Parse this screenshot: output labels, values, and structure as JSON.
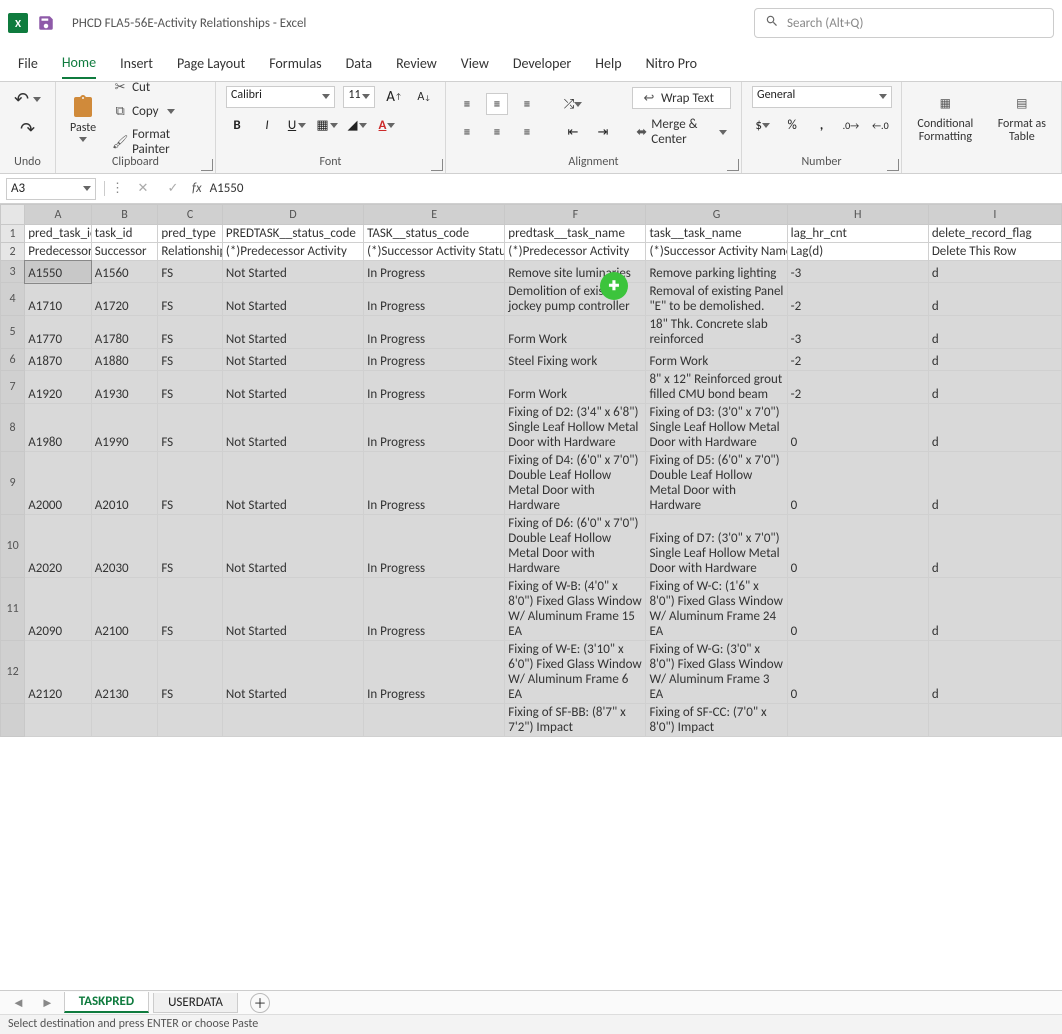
{
  "title": "PHCD FLA5-56E-Activity Relationships  -  Excel",
  "search_placeholder": "Search (Alt+Q)",
  "menu": [
    "File",
    "Home",
    "Insert",
    "Page Layout",
    "Formulas",
    "Data",
    "Review",
    "View",
    "Developer",
    "Help",
    "Nitro Pro"
  ],
  "menu_active": "Home",
  "ribbon": {
    "undo": "Undo",
    "clipboard": {
      "label": "Clipboard",
      "paste": "Paste",
      "cut": "Cut",
      "copy": "Copy",
      "format_painter": "Format Painter"
    },
    "font": {
      "label": "Font",
      "name": "Calibri",
      "size": "11"
    },
    "alignment": {
      "label": "Alignment",
      "wrap": "Wrap Text",
      "merge": "Merge & Center"
    },
    "number": {
      "label": "Number",
      "format": "General"
    },
    "cond": "Conditional Formatting",
    "fmt_table": "Format as Table"
  },
  "namebox": "A3",
  "formula": "A1550",
  "columns": [
    "A",
    "B",
    "C",
    "D",
    "E",
    "F",
    "G",
    "H",
    "I"
  ],
  "col_widths": [
    "col-A",
    "col-B",
    "col-C",
    "col-D",
    "col-E",
    "col-F",
    "col-G",
    "col-H",
    "col-I"
  ],
  "header_row1": [
    "pred_task_id",
    "task_id",
    "pred_type",
    "PREDTASK__status_code",
    "TASK__status_code",
    "predtask__task_name",
    "task__task_name",
    "lag_hr_cnt",
    "delete_record_flag"
  ],
  "header_row2": [
    "Predecessor",
    "Successor",
    "Relationship",
    "(*)Predecessor Activity",
    "(*)Successor Activity Status",
    "(*)Predecessor Activity",
    "(*)Successor Activity Name",
    "Lag(d)",
    "Delete This Row"
  ],
  "chart_data": {
    "type": "table",
    "columns": [
      "pred_task_id",
      "task_id",
      "pred_type",
      "PREDTASK__status_code",
      "TASK__status_code",
      "predtask__task_name",
      "task__task_name",
      "lag_hr_cnt",
      "delete_record_flag"
    ],
    "rows": [
      [
        "A1550",
        "A1560",
        "FS",
        "Not Started",
        "In Progress",
        "Remove site luminaries",
        "Remove parking lighting",
        "-3",
        "d"
      ],
      [
        "A1710",
        "A1720",
        "FS",
        "Not Started",
        "In Progress",
        "Demolition of existing jockey pump controller",
        "Removal of existing Panel \"E\" to be demolished.",
        "-2",
        "d"
      ],
      [
        "A1770",
        "A1780",
        "FS",
        "Not Started",
        "In Progress",
        "Form Work",
        "18\" Thk. Concrete slab reinforced",
        "-3",
        "d"
      ],
      [
        "A1870",
        "A1880",
        "FS",
        "Not Started",
        "In Progress",
        "Steel Fixing work",
        "Form Work",
        "-2",
        "d"
      ],
      [
        "A1920",
        "A1930",
        "FS",
        "Not Started",
        "In Progress",
        "Form Work",
        "8\" x 12\" Reinforced grout filled CMU bond beam",
        "-2",
        "d"
      ],
      [
        "A1980",
        "A1990",
        "FS",
        "Not Started",
        "In Progress",
        "Fixing of D2: (3'4\" x 6'8\") Single Leaf Hollow Metal Door with Hardware",
        "Fixing of D3: (3'0\" x 7'0\") Single Leaf Hollow Metal Door with Hardware",
        "0",
        "d"
      ],
      [
        "A2000",
        "A2010",
        "FS",
        "Not Started",
        "In Progress",
        "Fixing of D4: (6'0\" x 7'0\") Double Leaf Hollow Metal Door with Hardware",
        "Fixing of D5: (6'0\" x 7'0\") Double Leaf Hollow Metal Door with Hardware",
        "0",
        "d"
      ],
      [
        "A2020",
        "A2030",
        "FS",
        "Not Started",
        "In Progress",
        "Fixing of D6: (6'0\" x 7'0\") Double Leaf Hollow Metal Door with Hardware",
        "Fixing of D7: (3'0\" x 7'0\") Single Leaf Hollow Metal Door with Hardware",
        "0",
        "d"
      ],
      [
        "A2090",
        "A2100",
        "FS",
        "Not Started",
        "In Progress",
        "Fixing of W-B: (4'0\" x 8'0\") Fixed Glass Window  W/ Aluminum Frame 15 EA",
        "Fixing of W-C: (1'6\" x 8'0\") Fixed Glass Window  W/ Aluminum Frame 24 EA",
        "0",
        "d"
      ],
      [
        "A2120",
        "A2130",
        "FS",
        "Not Started",
        "In Progress",
        "Fixing of W-E: (3'10\" x 6'0\") Fixed Glass Window  W/ Aluminum Frame 6 EA",
        "Fixing of W-G: (3'0\" x 8'0\") Fixed Glass Window  W/ Aluminum Frame 3 EA",
        "0",
        "d"
      ],
      [
        "",
        "",
        "",
        "",
        "",
        "Fixing of SF-BB: (8'7\" x 7'2\") Impact",
        "Fixing of SF-CC: (7'0\" x 8'0\") Impact",
        "",
        ""
      ]
    ]
  },
  "row_numbers": [
    "1",
    "2",
    "3",
    "4",
    "5",
    "6",
    "7",
    "8",
    "9",
    "10",
    "11",
    "12",
    ""
  ],
  "sheets": {
    "active": "TASKPRED",
    "other": "USERDATA"
  },
  "status": "Select destination and press ENTER or choose Paste"
}
